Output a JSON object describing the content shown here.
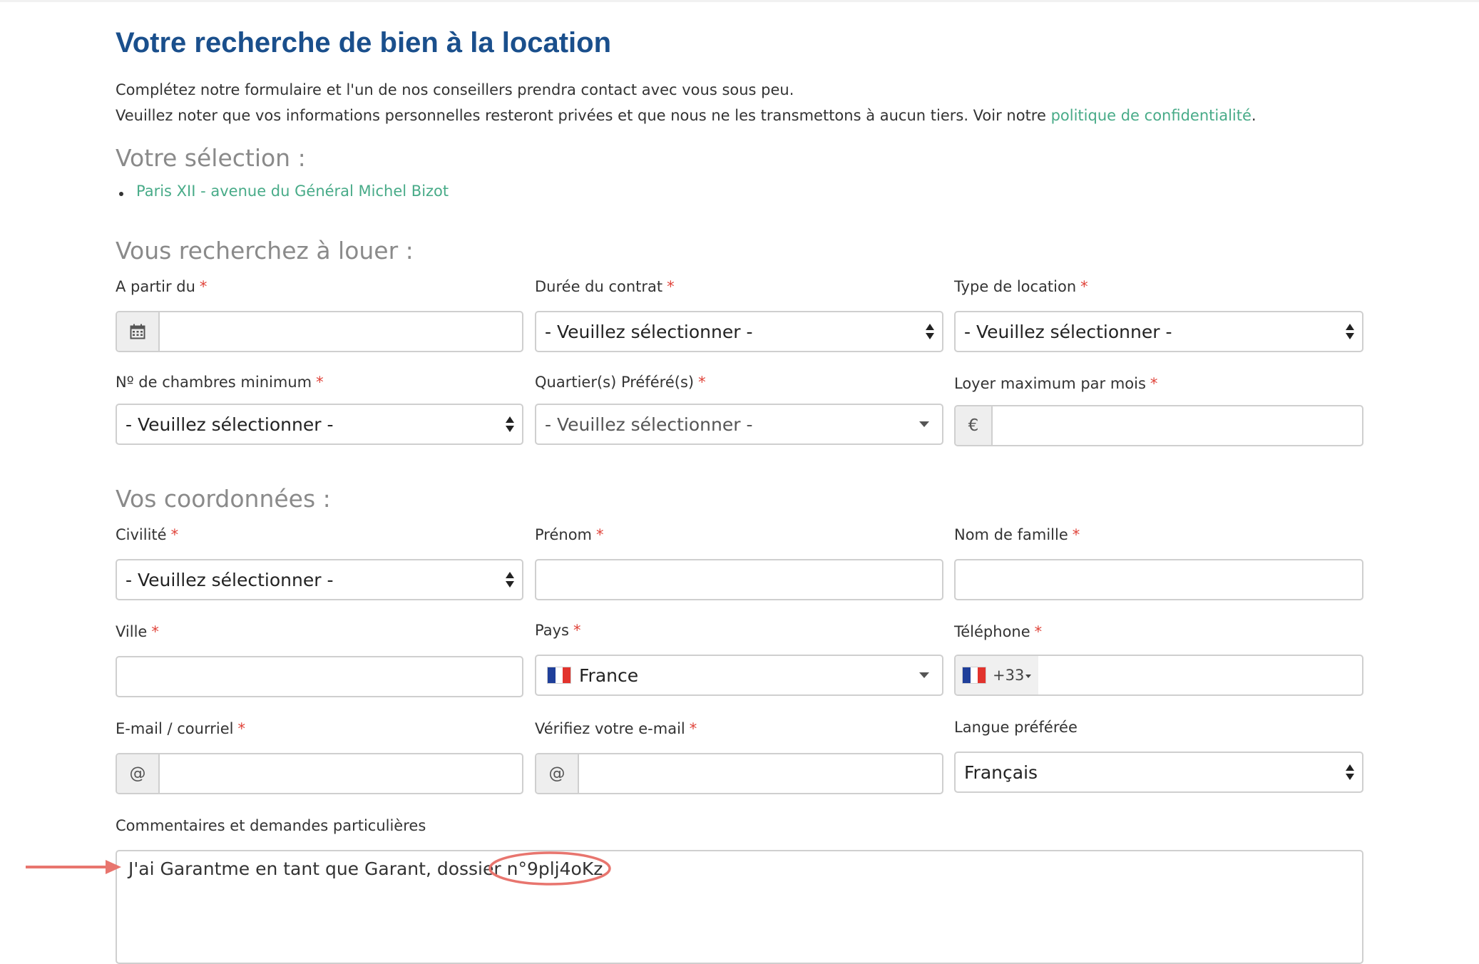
{
  "page": {
    "title": "Votre recherche de bien à la location",
    "intro_line1": "Complétez notre formulaire et l'un de nos conseillers prendra contact avec vous sous peu.",
    "intro_line2_before": "Veuillez noter que vos informations personnelles resteront privées et que nous ne les transmettons à aucun tiers. Voir notre ",
    "privacy_link": "politique de confidentialité",
    "intro_line2_after": "."
  },
  "selection": {
    "heading": "Votre sélection :",
    "items": [
      "Paris XII - avenue du Général Michel Bizot"
    ]
  },
  "search": {
    "heading": "Vous recherchez à louer :",
    "start_date": {
      "label": "A partir du",
      "value": "",
      "icon": "calendar-icon"
    },
    "duration": {
      "label": "Durée du contrat",
      "value": "- Veuillez sélectionner -"
    },
    "rental_type": {
      "label": "Type de location",
      "value": "- Veuillez sélectionner -"
    },
    "bedrooms": {
      "label": "Nº de chambres minimum",
      "value": "- Veuillez sélectionner -"
    },
    "districts": {
      "label": "Quartier(s) Préféré(s)",
      "value": "- Veuillez sélectionner -"
    },
    "max_rent": {
      "label": "Loyer maximum par mois",
      "addon": "€",
      "value": ""
    }
  },
  "contact": {
    "heading": "Vos coordonnées :",
    "title": {
      "label": "Civilité",
      "value": "- Veuillez sélectionner -"
    },
    "first_name": {
      "label": "Prénom",
      "value": ""
    },
    "last_name": {
      "label": "Nom de famille",
      "value": ""
    },
    "city": {
      "label": "Ville",
      "value": ""
    },
    "country": {
      "label": "Pays",
      "value": "France",
      "flag": "flag-france-icon"
    },
    "phone": {
      "label": "Téléphone",
      "dial_code": "+33",
      "value": "",
      "flag": "flag-france-icon"
    },
    "email": {
      "label": "E-mail / courriel",
      "addon": "@",
      "value": ""
    },
    "email_confirm": {
      "label": "Vérifiez votre e-mail",
      "addon": "@",
      "value": ""
    },
    "language": {
      "label": "Langue préférée",
      "value": "Français"
    },
    "comments": {
      "label": "Commentaires et demandes particulières",
      "value": "J'ai Garantme en tant que Garant, dossier n°9plj4oKz"
    }
  },
  "required_marker": "*",
  "colors": {
    "title": "#1a4f8c",
    "link": "#48ab88",
    "required": "#e0433a",
    "section_heading": "#8a8a8a",
    "annotation": "#e8756e",
    "border": "#cfcfcf"
  },
  "annotations": {
    "arrow": "arrow-icon",
    "highlight": "circle-highlight-icon"
  }
}
